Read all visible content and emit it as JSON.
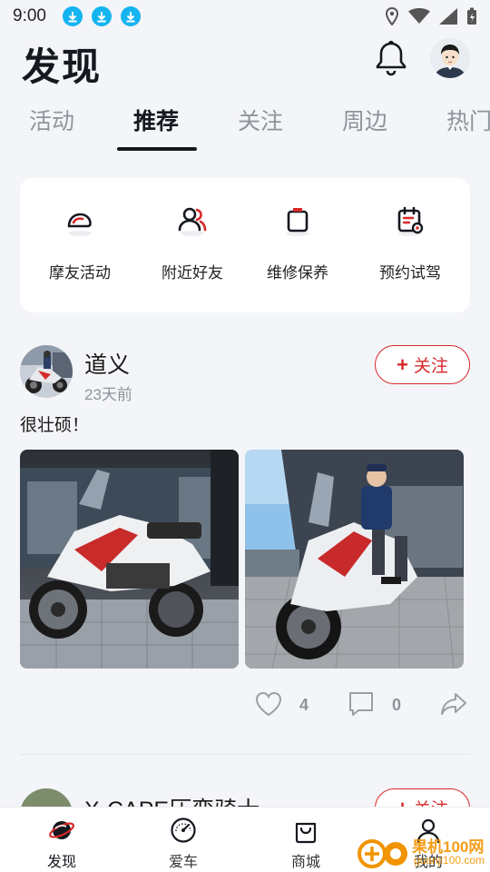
{
  "status_bar": {
    "time": "9:00"
  },
  "header": {
    "title": "发现"
  },
  "tabs": [
    {
      "label": "活动",
      "active": false
    },
    {
      "label": "推荐",
      "active": true
    },
    {
      "label": "关注",
      "active": false
    },
    {
      "label": "周边",
      "active": false
    },
    {
      "label": "热门",
      "active": false
    }
  ],
  "quick_actions": [
    {
      "label": "摩友活动",
      "icon": "helmet-icon"
    },
    {
      "label": "附近好友",
      "icon": "friends-icon"
    },
    {
      "label": "维修保养",
      "icon": "battery-icon"
    },
    {
      "label": "预约试驾",
      "icon": "calendar-icon"
    }
  ],
  "post": {
    "author": "道义",
    "time": "23天前",
    "follow_label": "关注",
    "text": "很壮硕！",
    "likes": "4",
    "comments": "0"
  },
  "post2": {
    "author": "X-CAPE压弯骑士",
    "follow_label": "关注"
  },
  "bottom_nav": [
    {
      "label": "发现",
      "icon": "planet-icon"
    },
    {
      "label": "爱车",
      "icon": "speedometer-icon"
    },
    {
      "label": "商城",
      "icon": "shopping-bag-icon"
    },
    {
      "label": "我的",
      "icon": "person-icon"
    }
  ],
  "watermark": {
    "line1": "果机100网",
    "line2": "guanji100.com"
  },
  "colors": {
    "accent_red": "#d6282a",
    "title_dark": "#15181f",
    "muted": "#8e939b",
    "download_blue": "#14b4f0"
  }
}
